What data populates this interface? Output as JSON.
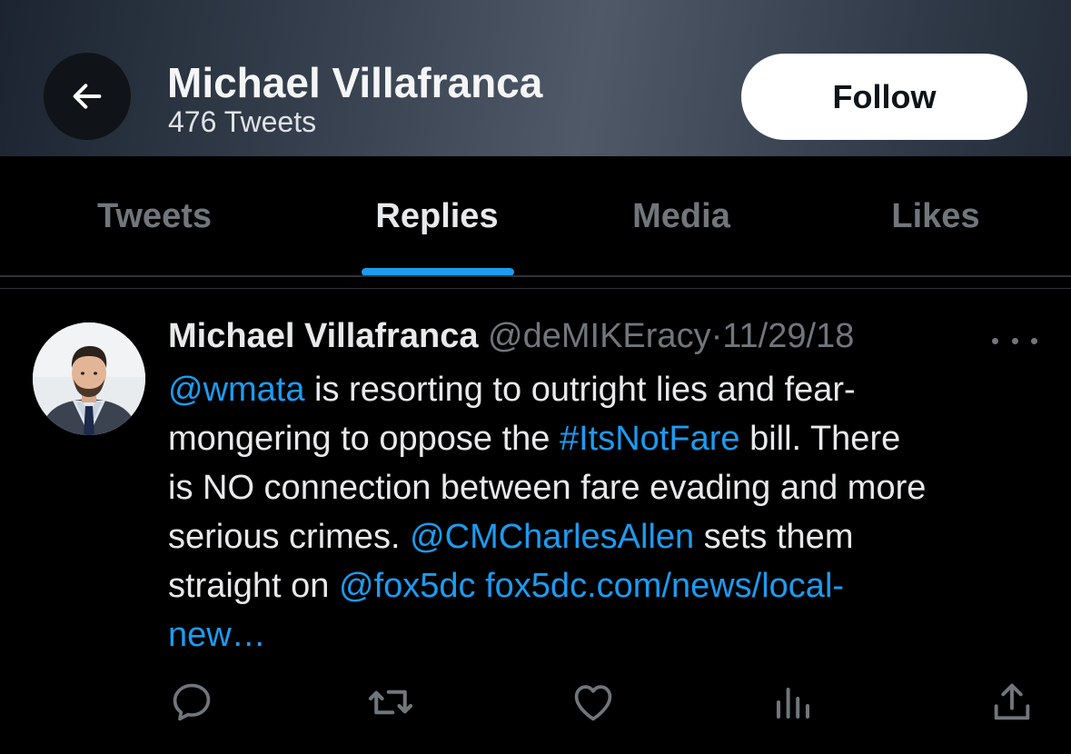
{
  "header": {
    "display_name": "Michael Villafranca",
    "tweet_count": "476 Tweets",
    "follow_label": "Follow",
    "back_icon": "arrow-left-icon"
  },
  "tabs": [
    {
      "label": "Tweets",
      "active": false
    },
    {
      "label": "Replies",
      "active": true
    },
    {
      "label": "Media",
      "active": false
    },
    {
      "label": "Likes",
      "active": false
    }
  ],
  "tweet": {
    "author_name": "Michael Villafranca",
    "handle": "@deMIKEracy",
    "separator": "·",
    "date": "11/29/18",
    "lines": {
      "l1_mention": "@wmata",
      "l1_text": " is resorting to outright lies and fear-",
      "l2_text": "mongering to oppose the ",
      "l2_hashtag": "#ItsNotFare",
      "l2_text_end": " bill. There",
      "l3_text": "is NO connection between fare evading and more",
      "l4_text": "serious crimes. ",
      "l4_mention": "@CMCharlesAllen",
      "l4_text_end": " sets them",
      "l5_text": "straight on ",
      "l5_mention": "@fox5dc",
      "l5_link": " fox5dc.com/news/local-",
      "l6_link": "new…"
    }
  },
  "actions": [
    "reply-icon",
    "retweet-icon",
    "like-icon",
    "views-icon",
    "share-icon"
  ],
  "colors": {
    "accent": "#1d9bf0",
    "background": "#000000",
    "text_primary": "#e7e9ea",
    "text_secondary": "#71767b"
  }
}
